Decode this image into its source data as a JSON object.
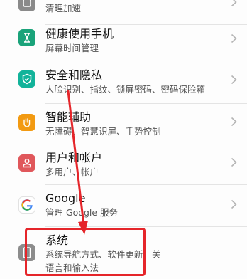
{
  "items": [
    {
      "title": "",
      "subtitle": "清理加速",
      "icon": "cleanup-icon",
      "color": "#8a8a8a"
    },
    {
      "title": "健康使用手机",
      "subtitle": "屏幕时间管理",
      "icon": "hourglass-icon",
      "color": "#1aa37a"
    },
    {
      "title": "安全和隐私",
      "subtitle": "人脸识别、指纹、锁屏密码、密码保险箱",
      "icon": "shield-icon",
      "color": "#12b39a"
    },
    {
      "title": "智能辅助",
      "subtitle": "无障碍、智慧识屏、手势控制",
      "icon": "hand-icon",
      "color": "#f29a12"
    },
    {
      "title": "用户和帐户",
      "subtitle": "多用户、帐户",
      "icon": "user-icon",
      "color": "#e0575b"
    },
    {
      "title": "Google",
      "subtitle": "管理 Google 服务",
      "icon": "google-icon",
      "color": "#ffffff"
    },
    {
      "title": "系统",
      "subtitle": "系统导航方式、软件更新、关",
      "subtitle2": "语言和输入法",
      "icon": "system-phone-icon",
      "color": "#8c8c8c"
    }
  ],
  "annotation": {
    "box_color": "#e5252a",
    "arrow_color": "#e5252a"
  }
}
